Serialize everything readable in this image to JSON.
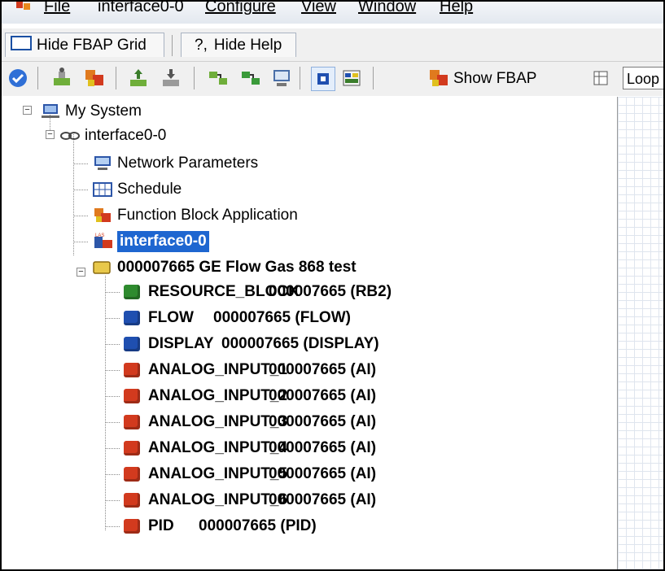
{
  "menu": {
    "file": "File",
    "interface": "interface0-0",
    "configure": "Configure",
    "view": "View",
    "window": "Window",
    "help": "Help"
  },
  "tabs": {
    "hide_fbap_grid": "Hide FBAP Grid",
    "hide_help_icon": "?,",
    "hide_help": "Hide Help"
  },
  "toolbar": {
    "show_fbap": "Show FBAP",
    "loop_value": "Loop T",
    "icons": [
      "check-circle-icon",
      "device-tag-icon",
      "function-block-icon",
      "upload-icon",
      "download-icon",
      "link-icon",
      "link-alt-icon",
      "monitor-icon",
      "tag-view-icon",
      "grid-view-icon",
      "fbap-icon",
      "grid-icon"
    ]
  },
  "tree": {
    "my_system": "My System",
    "interface": "interface0-0",
    "network_parameters": "Network Parameters",
    "schedule": "Schedule",
    "function_block_application": "Function Block Application",
    "interface_selected": "interface0-0",
    "device": "000007665 GE Flow Gas 868 test",
    "blocks": [
      {
        "name": "RESOURCE_BLOCK",
        "value": "000007665 (RB2)",
        "color": "#2e8b2e",
        "kind": "resource"
      },
      {
        "name": "FLOW",
        "value": "000007665 (FLOW)",
        "color": "#1f4fb0",
        "kind": "transducer"
      },
      {
        "name": "DISPLAY",
        "value": "000007665 (DISPLAY)",
        "color": "#1f4fb0",
        "kind": "transducer"
      },
      {
        "name": "ANALOG_INPUT_1",
        "value": "000007665 (AI)",
        "color": "#d23a1e",
        "kind": "function"
      },
      {
        "name": "ANALOG_INPUT_2",
        "value": "000007665 (AI)",
        "color": "#d23a1e",
        "kind": "function"
      },
      {
        "name": "ANALOG_INPUT_3",
        "value": "000007665 (AI)",
        "color": "#d23a1e",
        "kind": "function"
      },
      {
        "name": "ANALOG_INPUT_4",
        "value": "000007665 (AI)",
        "color": "#d23a1e",
        "kind": "function"
      },
      {
        "name": "ANALOG_INPUT_5",
        "value": "000007665 (AI)",
        "color": "#d23a1e",
        "kind": "function"
      },
      {
        "name": "ANALOG_INPUT_6",
        "value": "000007665 (AI)",
        "color": "#d23a1e",
        "kind": "function"
      },
      {
        "name": "PID",
        "value": "000007665 (PID)",
        "color": "#d23a1e",
        "kind": "function"
      }
    ]
  },
  "colors": {
    "selection": "#1e66d0",
    "accent": "#1a4fa3"
  }
}
